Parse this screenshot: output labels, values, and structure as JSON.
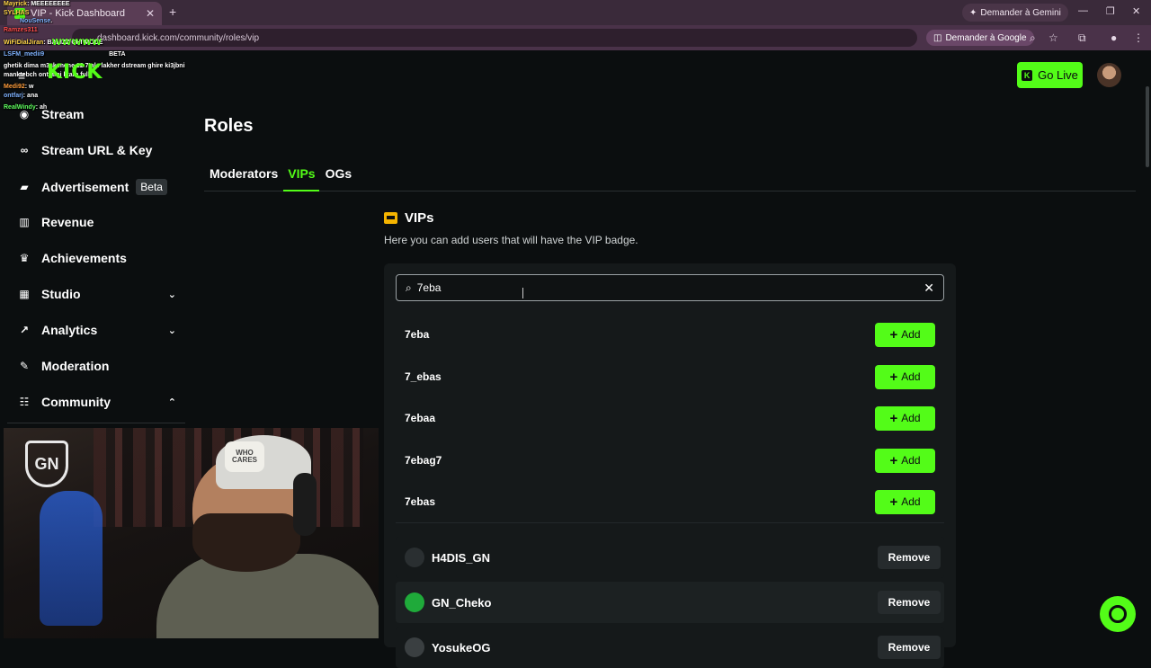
{
  "browser": {
    "tab_title": "VIP - Kick Dashboard",
    "new_tab_symbol": "+",
    "url": "dashboard.kick.com/community/roles/vip",
    "gemini_chip": "Demander à Gemini",
    "google_chip": "Demander à Google"
  },
  "chat_overlay": {
    "lines": [
      {
        "user": "Mayrick",
        "text": ": MEEEEEEEE"
      },
      {
        "user": "SYLHAS",
        "text": ""
      },
      {
        "user": "NouSense",
        "text": "."
      },
      {
        "user": "Ramzes311",
        "text": ""
      },
      {
        "user": "WiFiDialJiran",
        "text": ": BALIZZ CHI MODE"
      },
      {
        "user": "LSFM_medii9",
        "text": "BETA"
      },
      {
        "user": "",
        "text": "ghetik dima m3ak mene 12 7tale lakher dstream ghire ki3jbni manktebch ontfarej ktare full"
      },
      {
        "user": "Medi92",
        "text": ": w"
      },
      {
        "user": "ontfarj",
        "text": ": ana"
      },
      {
        "user": "RealWindy",
        "text": ": ah"
      }
    ],
    "overlay_wave": "wwwww",
    "overlay_logo": "KICK"
  },
  "header": {
    "go_live_label": "Go Live",
    "go_live_icon_letter": "K"
  },
  "sidebar": {
    "items": [
      {
        "label": "Stream",
        "icon": "camera-icon",
        "glyph": "◉"
      },
      {
        "label": "Stream URL & Key",
        "icon": "link-icon",
        "glyph": "∞"
      },
      {
        "label": "Advertisement",
        "icon": "megaphone-icon",
        "glyph": "▰",
        "badge": "Beta"
      },
      {
        "label": "Revenue",
        "icon": "chart-icon",
        "glyph": "▥"
      },
      {
        "label": "Achievements",
        "icon": "trophy-icon",
        "glyph": "♛"
      },
      {
        "label": "Studio",
        "icon": "studio-icon",
        "glyph": "▦",
        "chevron": "⌄"
      },
      {
        "label": "Analytics",
        "icon": "analytics-icon",
        "glyph": "↗",
        "chevron": "⌄"
      },
      {
        "label": "Moderation",
        "icon": "wrench-icon",
        "glyph": "✎"
      },
      {
        "label": "Community",
        "icon": "community-icon",
        "glyph": "☷",
        "chevron": "⌃"
      }
    ]
  },
  "webcam": {
    "cap_text": "WHO CARES",
    "logo_text": "GN"
  },
  "main": {
    "title": "Roles",
    "tabs": [
      "Moderators",
      "VIPs",
      "OGs"
    ],
    "active_tab": "VIPs",
    "section_title": "VIPs",
    "section_description": "Here you can add users that will have the VIP badge.",
    "search_value": "7eba",
    "search_results": [
      {
        "name": "7eba",
        "action": "Add"
      },
      {
        "name": "7_ebas",
        "action": "Add"
      },
      {
        "name": "7ebaa",
        "action": "Add"
      },
      {
        "name": "7ebag7",
        "action": "Add"
      },
      {
        "name": "7ebas",
        "action": "Add"
      }
    ],
    "vips": [
      {
        "name": "H4DIS_GN",
        "action": "Remove",
        "avatar_color": "#2a2f31"
      },
      {
        "name": "GN_Cheko",
        "action": "Remove",
        "avatar_color": "#1faa3a"
      },
      {
        "name": "YosukeOG",
        "action": "Remove",
        "avatar_color": "#3a3f41"
      }
    ]
  },
  "colors": {
    "accent": "#53fc18",
    "background": "#0b0e0f",
    "panel": "#15191a",
    "crown": "#f5b400"
  }
}
